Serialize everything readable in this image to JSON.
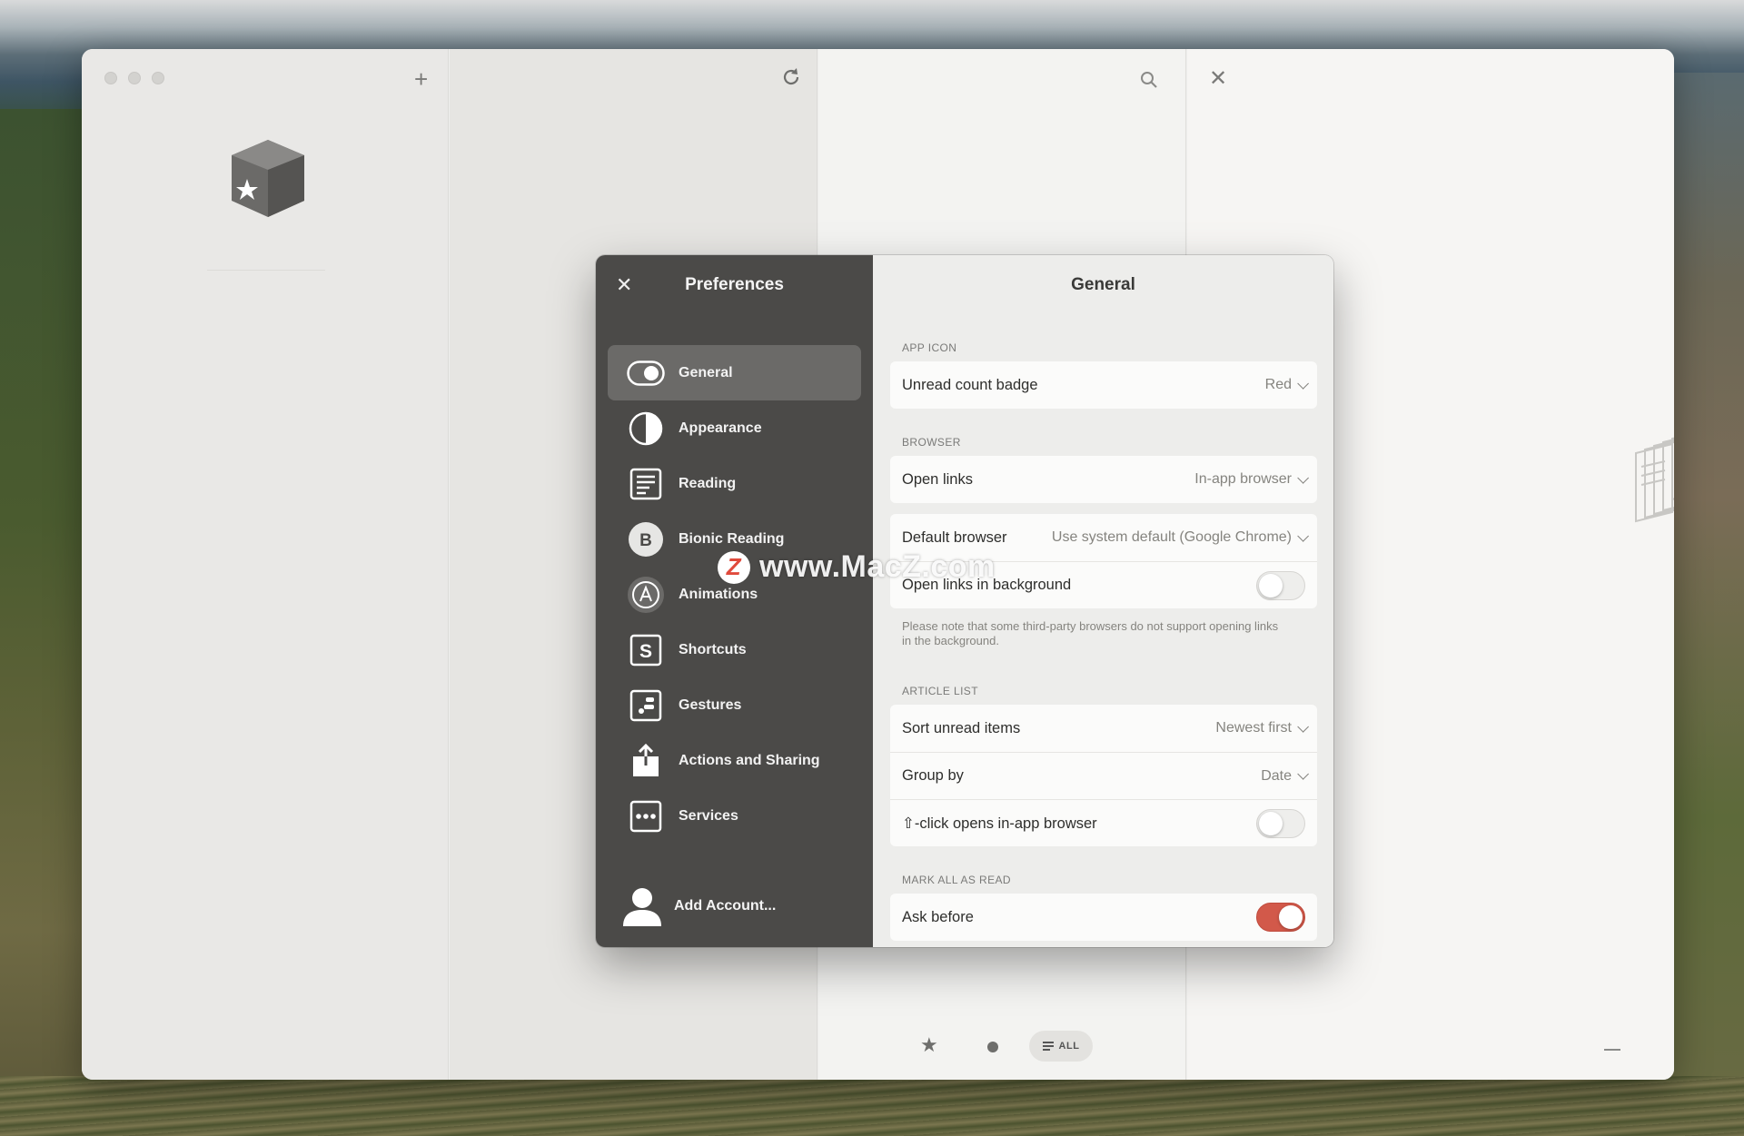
{
  "prefs": {
    "title": "Preferences",
    "nav": [
      {
        "label": "General",
        "icon": "toggle-icon"
      },
      {
        "label": "Appearance",
        "icon": "half-circle-icon"
      },
      {
        "label": "Reading",
        "icon": "document-lines-icon"
      },
      {
        "label": "Bionic Reading",
        "icon": "br-badge-icon"
      },
      {
        "label": "Animations",
        "icon": "letter-a-circle-icon"
      },
      {
        "label": "Shortcuts",
        "icon": "letter-s-square-icon"
      },
      {
        "label": "Gestures",
        "icon": "gesture-icon"
      },
      {
        "label": "Actions and Sharing",
        "icon": "share-icon"
      },
      {
        "label": "Services",
        "icon": "dots-square-icon"
      }
    ],
    "active_nav": "General",
    "add_account": "Add Account..."
  },
  "general": {
    "title": "General",
    "app_icon": {
      "section": "APP ICON",
      "unread_badge_label": "Unread count badge",
      "unread_badge_value": "Red"
    },
    "browser": {
      "section": "BROWSER",
      "open_links_label": "Open links",
      "open_links_value": "In-app browser",
      "default_browser_label": "Default browser",
      "default_browser_value": "Use system default (Google Chrome)",
      "open_in_background_label": "Open links in background",
      "open_in_background_on": false,
      "note": "Please note that some third-party browsers do not support opening links in the background."
    },
    "article_list": {
      "section": "ARTICLE LIST",
      "sort_label": "Sort unread items",
      "sort_value": "Newest first",
      "group_label": "Group by",
      "group_value": "Date",
      "shift_click_label": "⇧-click opens in-app browser",
      "shift_click_on": false
    },
    "mark_all": {
      "section": "MARK ALL AS READ",
      "ask_before_label": "Ask before",
      "ask_before_on": true
    }
  },
  "bottom_bar": {
    "all_label": "ALL"
  },
  "watermark": {
    "letter": "Z",
    "text": "www.MacZ.com"
  },
  "colors": {
    "accent": "#d2594a",
    "sidebar": "#4b4a48",
    "sidebar_active": "#6b6a68"
  }
}
